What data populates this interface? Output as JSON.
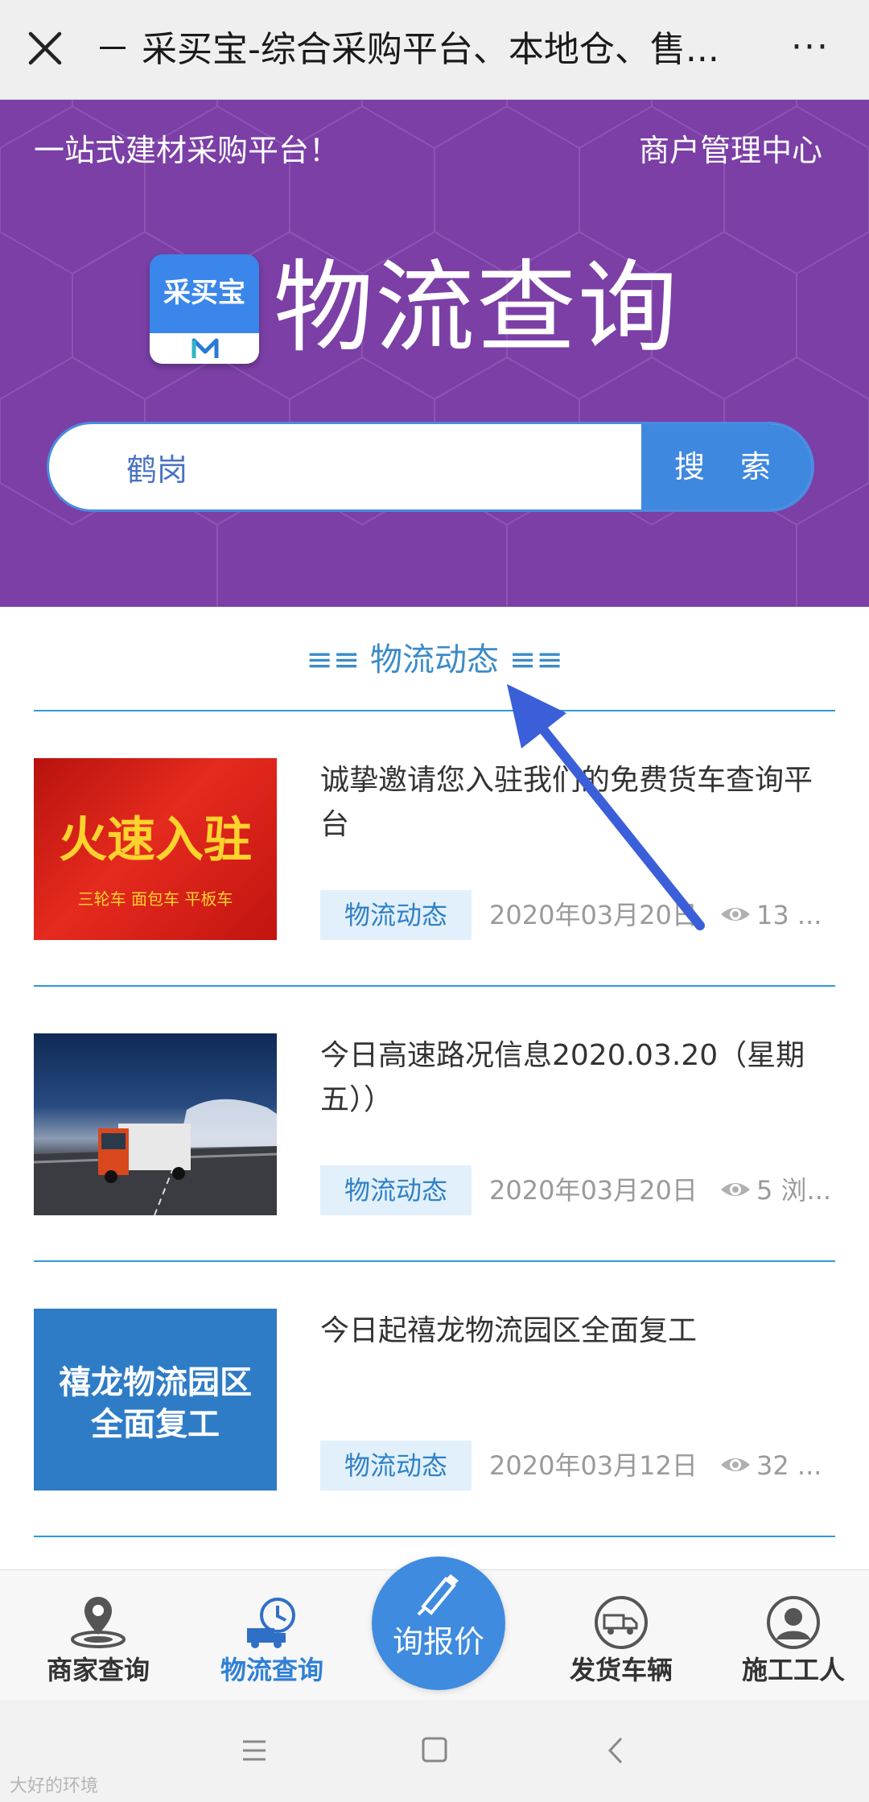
{
  "titlebar": {
    "title": "－ 采买宝-综合采购平台、本地仓、售...",
    "more": "···"
  },
  "hero": {
    "slogan": "一站式建材采购平台！",
    "merchant_center": "商户管理中心",
    "logo_text": "采买宝",
    "big_title": "物流查询"
  },
  "search": {
    "value": "鹤岗",
    "button": "搜 索"
  },
  "section": {
    "label": "≡≡  物流动态  ≡≡"
  },
  "news": [
    {
      "title": "诚挚邀请您入驻我们的免费货车查询平台",
      "tag": "物流动态",
      "date": "2020年03月20日",
      "views": "13 ...",
      "thumb_big": "火速入驻",
      "thumb_small": "三轮车 面包车 平板车"
    },
    {
      "title": "今日高速路况信息2020.03.20（星期五））",
      "tag": "物流动态",
      "date": "2020年03月20日",
      "views": "5 浏..."
    },
    {
      "title": "今日起禧龙物流园区全面复工",
      "tag": "物流动态",
      "date": "2020年03月12日",
      "views": "32 ...",
      "thumb_text_1": "禧龙物流园区",
      "thumb_text_2": "全面复工"
    }
  ],
  "bottom_nav": {
    "items": [
      {
        "label": "商家查询",
        "icon": "merchant-location-icon"
      },
      {
        "label": "物流查询",
        "icon": "delivery-clock-icon",
        "active": true
      },
      {
        "label": "发货车辆",
        "icon": "truck-icon"
      },
      {
        "label": "施工工人",
        "icon": "worker-icon"
      }
    ],
    "center": {
      "label": "询报价",
      "icon": "pen-icon"
    }
  },
  "watermark": "大好的环境",
  "colors": {
    "hero_purple": "#7b3fa6",
    "accent_blue": "#3f88e0",
    "section_blue": "#3c8bc8"
  }
}
